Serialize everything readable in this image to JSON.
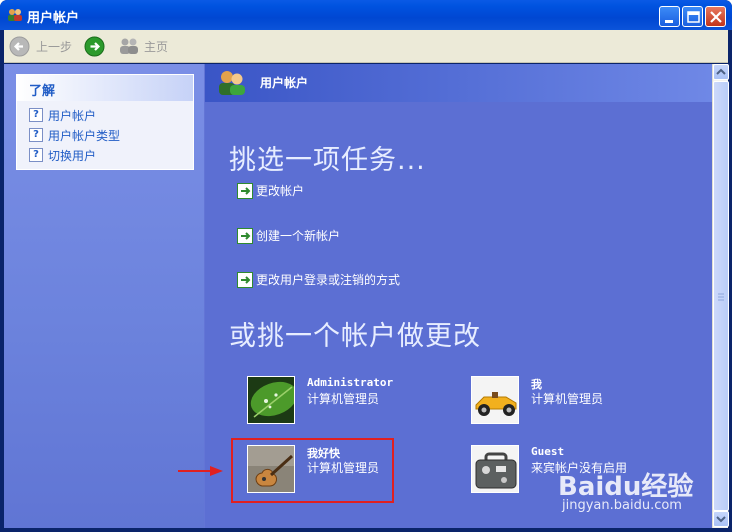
{
  "window": {
    "title": "用户帐户",
    "accent": "#0053e0"
  },
  "toolbar": {
    "back_label": "上一步",
    "home_label": "主页"
  },
  "sidebar": {
    "section_title": "了解",
    "items": [
      {
        "label": "用户帐户",
        "icon": "help-icon"
      },
      {
        "label": "用户帐户类型",
        "icon": "help-icon"
      },
      {
        "label": "切换用户",
        "icon": "help-icon"
      }
    ]
  },
  "main": {
    "header_title": "用户帐户",
    "pick_task_heading": "挑选一项任务...",
    "tasks": [
      {
        "label": "更改帐户",
        "icon": "green-arrow-icon"
      },
      {
        "label": "创建一个新帐户",
        "icon": "green-arrow-icon"
      },
      {
        "label": "更改用户登录或注销的方式",
        "icon": "green-arrow-icon"
      }
    ],
    "pick_account_heading": "或挑一个帐户做更改",
    "accounts": [
      {
        "name": "Administrator",
        "role": "计算机管理员",
        "picture": "green-leaf-picture"
      },
      {
        "name": "我",
        "role": "计算机管理员",
        "picture": "race-car-picture"
      },
      {
        "name": "我好快",
        "role": "计算机管理员",
        "picture": "guitar-picture"
      },
      {
        "name": "Guest",
        "role": "来宾帐户没有启用",
        "picture": "suitcase-picture"
      }
    ]
  },
  "watermark": {
    "brand": "Baidu经验",
    "url": "jingyan.baidu.com"
  }
}
